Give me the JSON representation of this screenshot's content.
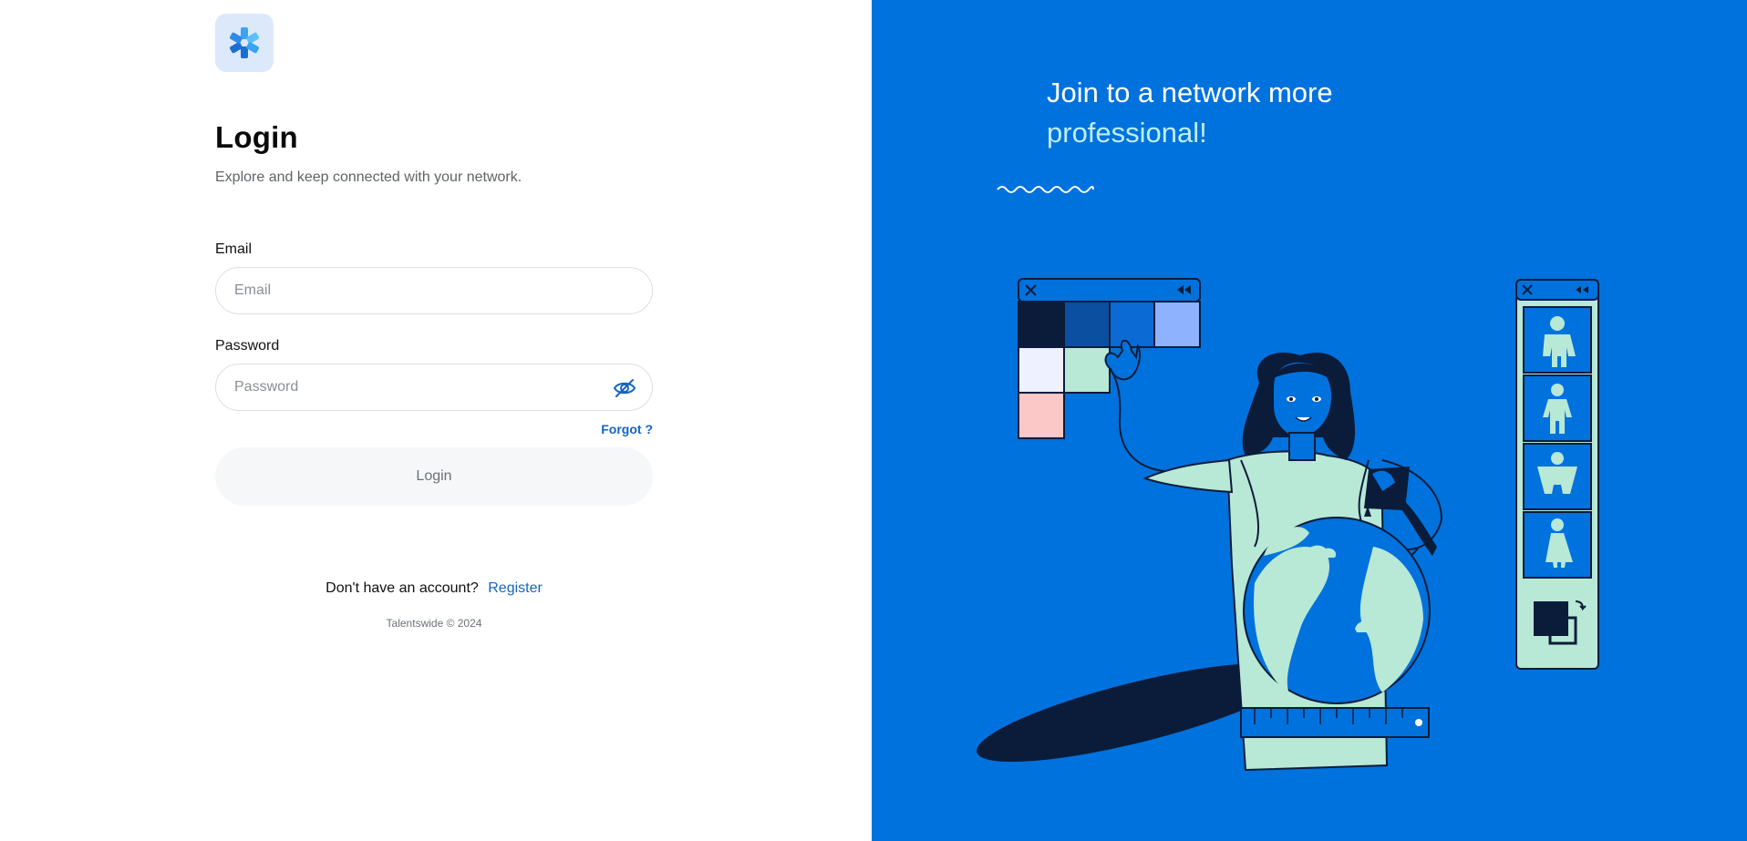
{
  "login": {
    "title": "Login",
    "subtitle": "Explore and keep connected with your network.",
    "email_label": "Email",
    "email_placeholder": "Email",
    "email_value": "",
    "password_label": "Password",
    "password_placeholder": "Password",
    "password_value": "",
    "forgot_label": "Forgot ?",
    "login_button": "Login",
    "no_account_text": "Don't have an account?",
    "register_link": "Register",
    "footer": "Talentswide © 2024"
  },
  "promo": {
    "headline_line1": "Join to a network more",
    "headline_line2": "professional!"
  },
  "icons": {
    "logo": "snowflake-logo-icon",
    "password_toggle": "eye-off-icon"
  },
  "colors": {
    "brand_blue": "#0072DD",
    "link_blue": "#1565C0",
    "accent_text": "#BDEFF3",
    "mint": "#B8E8D6",
    "navy": "#0B1C3A"
  }
}
